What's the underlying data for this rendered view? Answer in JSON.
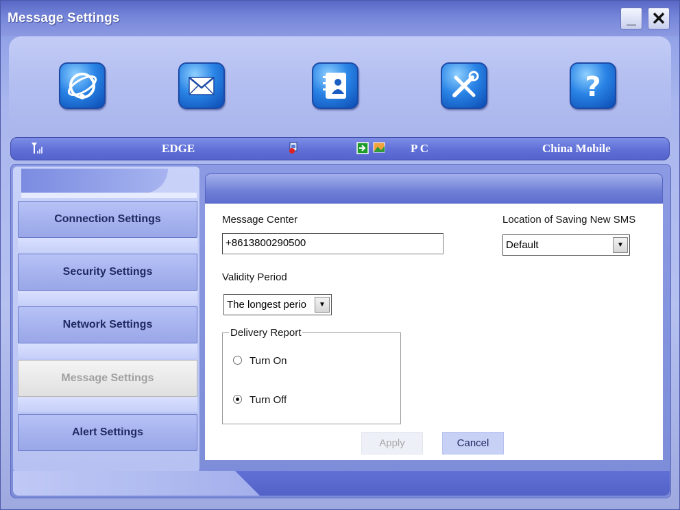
{
  "window": {
    "title": "Message Settings"
  },
  "toolbar": {
    "icons": [
      "internet-icon",
      "mail-icon",
      "contacts-icon",
      "settings-tools-icon",
      "help-icon"
    ]
  },
  "status": {
    "network_type": "EDGE",
    "connection": "P C",
    "operator": "China Mobile",
    "icons": [
      "signal-strength-icon",
      "sim-lock-icon",
      "arrow-in-icon",
      "landscape-icon"
    ]
  },
  "nav": {
    "items": [
      {
        "label": "Connection Settings"
      },
      {
        "label": "Security Settings"
      },
      {
        "label": "Network Settings"
      },
      {
        "label": "Message Settings",
        "active": true
      },
      {
        "label": "Alert Settings"
      }
    ]
  },
  "form": {
    "message_center_label": "Message Center",
    "message_center_value": "+8613800290500",
    "validity_period_label": "Validity Period",
    "validity_period_value": "The longest perio",
    "location_label": "Location of Saving New SMS",
    "location_value": "Default",
    "delivery_report_label": "Delivery Report",
    "turn_on_label": "Turn On",
    "turn_off_label": "Turn Off",
    "delivery_report_selected": "Turn Off",
    "apply_label": "Apply",
    "cancel_label": "Cancel"
  }
}
